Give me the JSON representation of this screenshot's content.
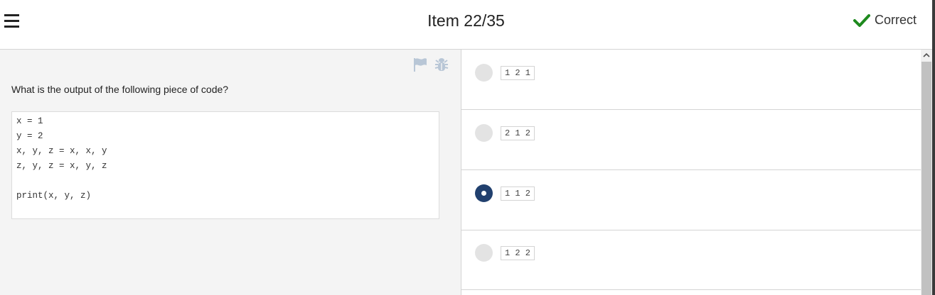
{
  "header": {
    "title": "Item 22/35",
    "status": "Correct",
    "status_color": "#1e8a1e",
    "menu_icon": "hamburger-menu-icon"
  },
  "question": {
    "prompt": "What is the output of the following piece of code?",
    "tools": [
      "flag-icon",
      "bug-icon"
    ],
    "code_lines": [
      "x = 1",
      "y = 2",
      "x, y, z = x, x, y",
      "z, y, z = x, y, z",
      "",
      "print(x, y, z)"
    ]
  },
  "answers": [
    {
      "text": "1 2 1",
      "selected": false
    },
    {
      "text": "2 1 2",
      "selected": false
    },
    {
      "text": "1 1 2",
      "selected": true
    },
    {
      "text": "1 2 2",
      "selected": false
    }
  ],
  "colors": {
    "selected_radio": "#21406e",
    "unselected_radio": "#e3e3e3",
    "left_pane_bg": "#f4f4f4"
  }
}
